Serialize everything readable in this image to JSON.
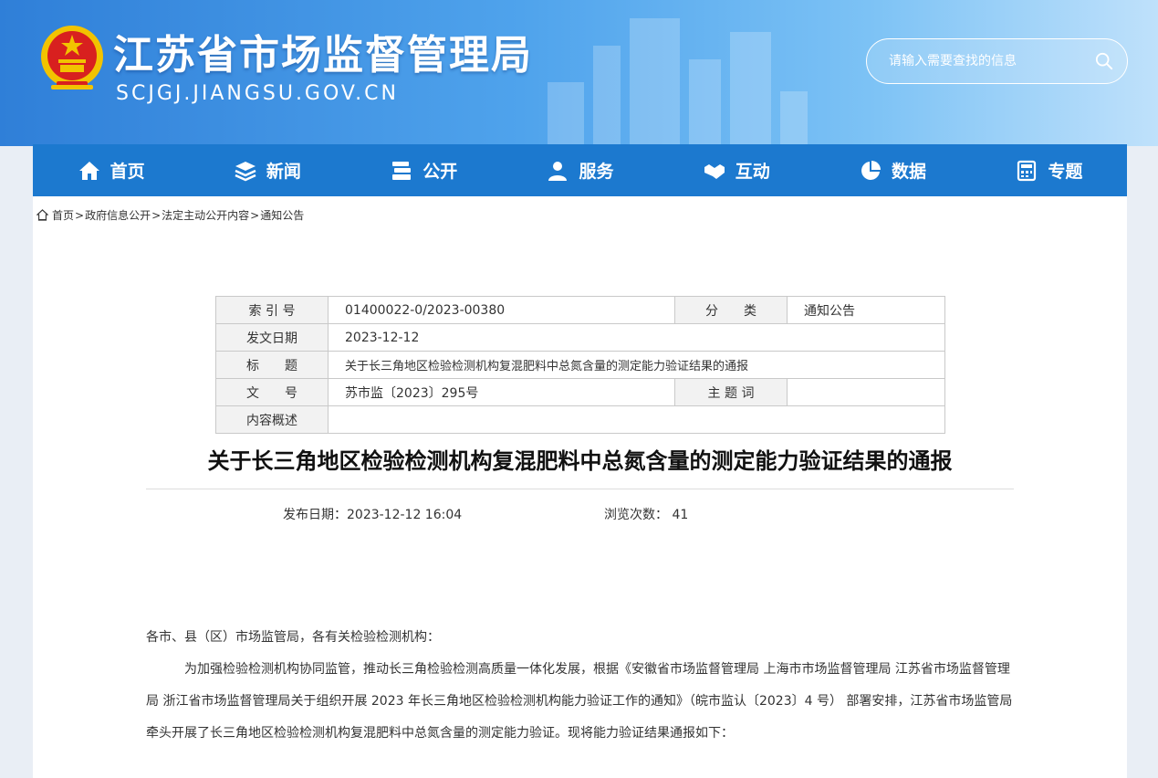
{
  "header": {
    "site_title": "江苏省市场监督管理局",
    "site_url": "SCJGJ.JIANGSU.GOV.CN",
    "search_placeholder": "请输入需要查找的信息"
  },
  "nav": {
    "items": [
      {
        "label": "首页",
        "icon": "home-icon"
      },
      {
        "label": "新闻",
        "icon": "layers-icon"
      },
      {
        "label": "公开",
        "icon": "stack-icon"
      },
      {
        "label": "服务",
        "icon": "users-icon"
      },
      {
        "label": "互动",
        "icon": "handshake-icon"
      },
      {
        "label": "数据",
        "icon": "pie-chart-icon"
      },
      {
        "label": "专题",
        "icon": "calculator-icon"
      }
    ]
  },
  "breadcrumb": [
    "首页",
    "政府信息公开",
    "法定主动公开内容",
    "通知公告"
  ],
  "meta": {
    "index_label": "索 引 号",
    "index_value": "01400022-0/2023-00380",
    "category_label": "分　　类",
    "category_value": "通知公告",
    "date_label": "发文日期",
    "date_value": "2023-12-12",
    "title_label": "标　　题",
    "title_value": "关于长三角地区检验检测机构复混肥料中总氮含量的测定能力验证结果的通报",
    "docno_label": "文　　号",
    "docno_value": "苏市监〔2023〕295号",
    "keywords_label": "主 题 词",
    "keywords_value": "",
    "summary_label": "内容概述",
    "summary_value": ""
  },
  "article": {
    "title": "关于长三角地区检验检测机构复混肥料中总氮含量的测定能力验证结果的通报",
    "publish_label": "发布日期：",
    "publish_value": "2023-12-12 16:04",
    "views_label": "浏览次数：",
    "views_value": "41",
    "salutation": "各市、县（区）市场监管局，各有关检验检测机构：",
    "paragraph": "为加强检验检测机构协同监管，推动长三角检验检测高质量一体化发展，根据《安徽省市场监督管理局 上海市市场监督管理局 江苏省市场监督管理局  浙江省市场监督管理局关于组织开展 2023 年长三角地区检验检测机构能力验证工作的通知》（皖市监认〔2023〕4 号） 部署安排，江苏省市场监管局牵头开展了长三角地区检验检测机构复混肥料中总氮含量的测定能力验证。现将能力验证结果通报如下："
  },
  "colors": {
    "nav_bg": "#1c79cf",
    "header_gradient_start": "#2f7fd8",
    "header_gradient_end": "#bfe1fb"
  }
}
